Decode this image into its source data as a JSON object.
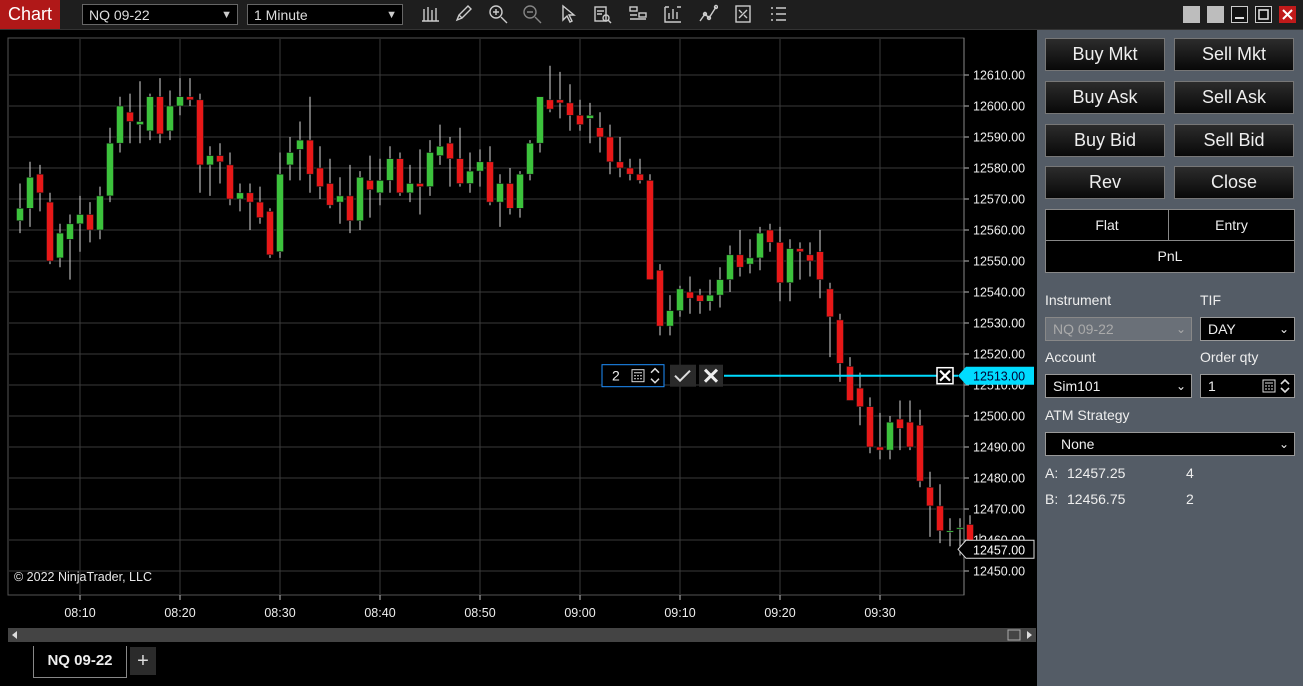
{
  "app": {
    "title": "Chart"
  },
  "toolbar": {
    "instrument": "NQ 09-22",
    "interval": "1 Minute",
    "icons": [
      "bars-type-icon",
      "draw-pencil-icon",
      "zoom-in-icon",
      "zoom-out-icon",
      "pointer-icon",
      "data-box-icon",
      "chart-trader-icon",
      "properties-icon",
      "strategies-icon",
      "indicators-icon",
      "templates-icon"
    ]
  },
  "chart": {
    "copyright": "© 2022 NinjaTrader, LLC",
    "order_line": {
      "qty": "2",
      "price": "12513.00"
    },
    "last_price": "12457.00",
    "colors": {
      "up": "#3cc23c",
      "down": "#e81818",
      "order_line": "#00dcff",
      "background": "#000000",
      "grid": "#3a3a3a"
    }
  },
  "chart_data": {
    "type": "candlestick",
    "instrument": "NQ 09-22",
    "interval": "1 Minute",
    "x_ticks": [
      "08:10",
      "08:20",
      "08:30",
      "08:40",
      "08:50",
      "09:00",
      "09:10",
      "09:20",
      "09:30"
    ],
    "y_ticks": [
      "12610.00",
      "12600.00",
      "12590.00",
      "12580.00",
      "12570.00",
      "12560.00",
      "12550.00",
      "12540.00",
      "12530.00",
      "12520.00",
      "12510.00",
      "12500.00",
      "12490.00",
      "12480.00",
      "12470.00",
      "12460.00",
      "12450.00"
    ],
    "ylim": [
      12443,
      12624
    ],
    "first_bar_time": "08:04",
    "bars": [
      [
        12563,
        12575,
        12559,
        12567
      ],
      [
        12567,
        12582,
        12561,
        12577
      ],
      [
        12578,
        12581,
        12566,
        12572
      ],
      [
        12569,
        12572,
        12549,
        12550
      ],
      [
        12551,
        12562,
        12548,
        12559
      ],
      [
        12557,
        12565,
        12544,
        12562
      ],
      [
        12562,
        12571,
        12553,
        12565
      ],
      [
        12565,
        12569,
        12556,
        12560
      ],
      [
        12560,
        12574,
        12557,
        12571
      ],
      [
        12571,
        12593,
        12569,
        12588
      ],
      [
        12588,
        12603,
        12585,
        12600
      ],
      [
        12598,
        12604,
        12588,
        12595
      ],
      [
        12594,
        12608,
        12588,
        12595
      ],
      [
        12592,
        12604,
        12589,
        12603
      ],
      [
        12603,
        12609,
        12588,
        12591
      ],
      [
        12592,
        12605,
        12589,
        12600
      ],
      [
        12600,
        12609,
        12597,
        12603
      ],
      [
        12603,
        12609,
        12600,
        12602
      ],
      [
        12602,
        12604,
        12572,
        12581
      ],
      [
        12581,
        12587,
        12571,
        12584
      ],
      [
        12584,
        12588,
        12575,
        12582
      ],
      [
        12581,
        12585,
        12568,
        12570
      ],
      [
        12570,
        12575,
        12566,
        12572
      ],
      [
        12572,
        12575,
        12560,
        12569
      ],
      [
        12569,
        12574,
        12562,
        12564
      ],
      [
        12566,
        12567,
        12551,
        12552
      ],
      [
        12553,
        12585,
        12551,
        12578
      ],
      [
        12581,
        12590,
        12576,
        12585
      ],
      [
        12586,
        12595,
        12576,
        12589
      ],
      [
        12589,
        12603,
        12572,
        12578
      ],
      [
        12580,
        12587,
        12570,
        12574
      ],
      [
        12575,
        12583,
        12567,
        12568
      ],
      [
        12569,
        12577,
        12562,
        12571
      ],
      [
        12571,
        12581,
        12559,
        12563
      ],
      [
        12563,
        12579,
        12560,
        12577
      ],
      [
        12576,
        12584,
        12564,
        12573
      ],
      [
        12572,
        12583,
        12568,
        12576
      ],
      [
        12576,
        12587,
        12572,
        12583
      ],
      [
        12583,
        12585,
        12571,
        12572
      ],
      [
        12572,
        12581,
        12569,
        12575
      ],
      [
        12575,
        12586,
        12565,
        12574
      ],
      [
        12574,
        12589,
        12571,
        12585
      ],
      [
        12584,
        12594,
        12581,
        12587
      ],
      [
        12588,
        12590,
        12574,
        12583
      ],
      [
        12583,
        12593,
        12574,
        12575
      ],
      [
        12575,
        12585,
        12572,
        12579
      ],
      [
        12579,
        12586,
        12574,
        12582
      ],
      [
        12582,
        12587,
        12568,
        12569
      ],
      [
        12569,
        12578,
        12561,
        12575
      ],
      [
        12575,
        12580,
        12565,
        12567
      ],
      [
        12567,
        12579,
        12564,
        12578
      ],
      [
        12578,
        12589,
        12576,
        12588
      ],
      [
        12588,
        12600,
        12585,
        12603
      ],
      [
        12602,
        12613,
        12598,
        12599
      ],
      [
        12602,
        12611,
        12596,
        12601
      ],
      [
        12601,
        12607,
        12592,
        12597
      ],
      [
        12597,
        12602,
        12592,
        12594
      ],
      [
        12596,
        12601,
        12588,
        12597
      ],
      [
        12593,
        12598,
        12585,
        12590
      ],
      [
        12590,
        12594,
        12578,
        12582
      ],
      [
        12582,
        12590,
        12577,
        12580
      ],
      [
        12580,
        12583,
        12576,
        12578
      ],
      [
        12578,
        12583,
        12575,
        12576
      ],
      [
        12576,
        12578,
        12544,
        12544
      ],
      [
        12547,
        12549,
        12526,
        12529
      ],
      [
        12529,
        12539,
        12526,
        12534
      ],
      [
        12534,
        12542,
        12532,
        12541
      ],
      [
        12540,
        12545,
        12533,
        12538
      ],
      [
        12539,
        12541,
        12533,
        12537
      ],
      [
        12537,
        12544,
        12534,
        12539
      ],
      [
        12539,
        12548,
        12535,
        12544
      ],
      [
        12544,
        12555,
        12540,
        12552
      ],
      [
        12552,
        12560,
        12545,
        12548
      ],
      [
        12549,
        12557,
        12546,
        12551
      ],
      [
        12551,
        12561,
        12547,
        12559
      ],
      [
        12560,
        12562,
        12553,
        12556
      ],
      [
        12556,
        12561,
        12537,
        12543
      ],
      [
        12543,
        12557,
        12537,
        12554
      ],
      [
        12554,
        12556,
        12544,
        12553
      ],
      [
        12552,
        12556,
        12545,
        12550
      ],
      [
        12553,
        12560,
        12538,
        12544
      ],
      [
        12541,
        12543,
        12519,
        12532
      ],
      [
        12531,
        12533,
        12511,
        12517
      ],
      [
        12516,
        12519,
        12505,
        12505
      ],
      [
        12509,
        12514,
        12497,
        12503
      ],
      [
        12503,
        12506,
        12488,
        12490
      ],
      [
        12490,
        12501,
        12486,
        12489
      ],
      [
        12489,
        12500,
        12486,
        12498
      ],
      [
        12499,
        12505,
        12489,
        12496
      ],
      [
        12498,
        12505,
        12489,
        12490
      ],
      [
        12497,
        12502,
        12477,
        12479
      ],
      [
        12477,
        12482,
        12461,
        12471
      ],
      [
        12471,
        12478,
        12459,
        12463
      ],
      [
        12463,
        12467,
        12458,
        12463
      ],
      [
        12464,
        12467,
        12455,
        12464
      ],
      [
        12465,
        12468,
        12454,
        12458
      ],
      [
        12458,
        12462,
        12454,
        12457
      ]
    ]
  },
  "panel": {
    "buttons": {
      "buy_mkt": "Buy Mkt",
      "sell_mkt": "Sell Mkt",
      "buy_ask": "Buy Ask",
      "sell_ask": "Sell Ask",
      "buy_bid": "Buy Bid",
      "sell_bid": "Sell Bid",
      "rev": "Rev",
      "close": "Close"
    },
    "position": {
      "flat": "Flat",
      "entry": "Entry",
      "pnl": "PnL"
    },
    "instrument_label": "Instrument",
    "instrument_value": "NQ 09-22",
    "tif_label": "TIF",
    "tif_value": "DAY",
    "account_label": "Account",
    "account_value": "Sim101",
    "order_qty_label": "Order qty",
    "order_qty_value": "1",
    "atm_label": "ATM Strategy",
    "atm_value": "None",
    "ask_label": "A:",
    "ask_price": "12457.25",
    "ask_size": "4",
    "bid_label": "B:",
    "bid_price": "12456.75",
    "bid_size": "2"
  },
  "tabs": {
    "active": "NQ 09-22",
    "add": "+"
  }
}
